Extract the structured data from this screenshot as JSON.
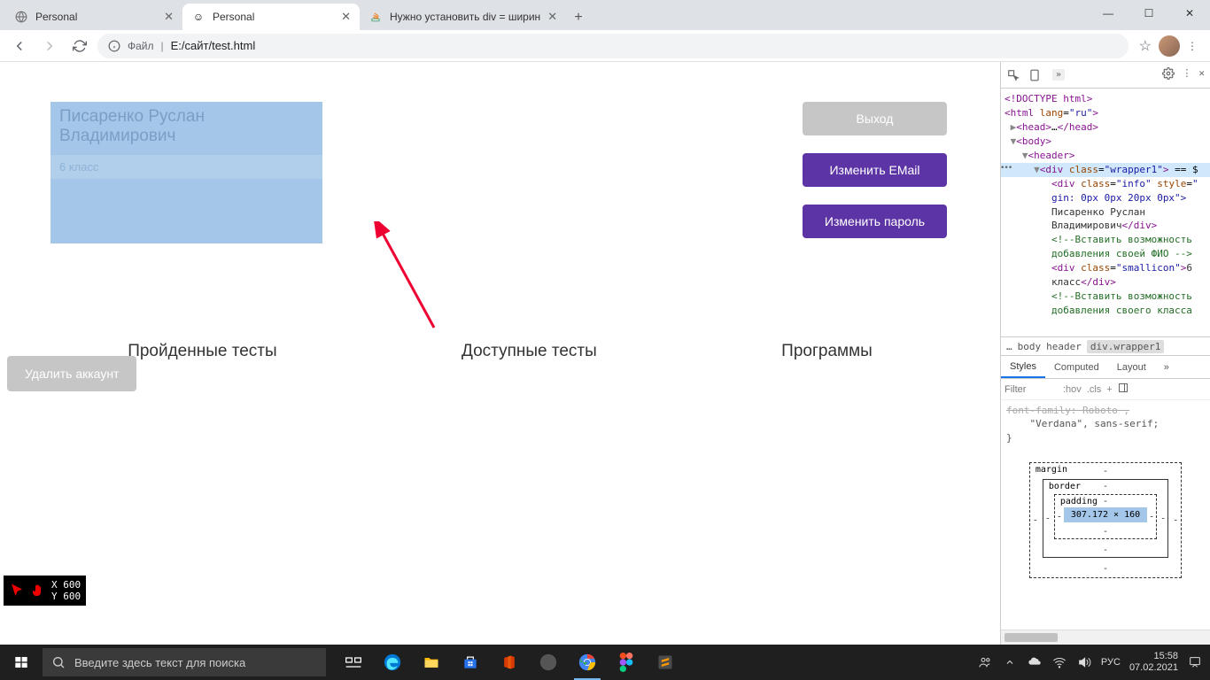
{
  "browser": {
    "tabs": [
      {
        "title": "Personal"
      },
      {
        "title": "Personal"
      },
      {
        "title": "Нужно установить div = ширин"
      }
    ],
    "url_label": "Файл",
    "url": "E:/сайт/test.html"
  },
  "page": {
    "info_name": "Писаренко Руслан Владимирович",
    "class_label": "6 класс",
    "btn_exit": "Выход",
    "btn_email": "Изменить EMail",
    "btn_password": "Изменить пароль",
    "section_passed": "Пройденные тесты",
    "section_available": "Доступные тесты",
    "section_programs": "Программы",
    "btn_delete": "Удалить аккаунт"
  },
  "coord": {
    "x": "X 600",
    "y": "Y 600"
  },
  "devtools": {
    "tree": {
      "doctype": "<!DOCTYPE html>",
      "html_open": "<html lang=\"ru\">",
      "head": "<head>…</head>",
      "body": "<body>",
      "header": "<header>",
      "wrapper_sel": "<div class=\"wrapper1\"> == $",
      "info_open": "<div class=\"info\" style=\"",
      "info_style": "gin: 0px 0px 20px 0px\">",
      "info_text1": "Писаренко Руслан",
      "info_text2": "Владимирович</div>",
      "comment1a": "<!--Вставить возможность",
      "comment1b": "добавления своей ФИО -->",
      "small_open": "<div class=\"smallicon\">6",
      "small_close": "класс</div>",
      "comment2a": "<!--Вставить возможность",
      "comment2b": "добавления своего класса"
    },
    "breadcrumb": {
      "dots": "…",
      "body": "body",
      "header": "header",
      "sel": "div.wrapper1"
    },
    "styles_tabs": {
      "styles": "Styles",
      "computed": "Computed",
      "layout": "Layout"
    },
    "filter_placeholder": "Filter",
    "filter_hov": ":hov",
    "filter_cls": ".cls",
    "rule_line1": "font-family: Roboto ,",
    "rule_line2": "\"Verdana\", sans-serif;",
    "box_model": {
      "margin": "margin",
      "border": "border",
      "padding": "padding",
      "content": "307.172 × 160"
    }
  },
  "taskbar": {
    "search_placeholder": "Введите здесь текст для поиска",
    "lang": "РУС",
    "time": "15:58",
    "date": "07.02.2021"
  }
}
